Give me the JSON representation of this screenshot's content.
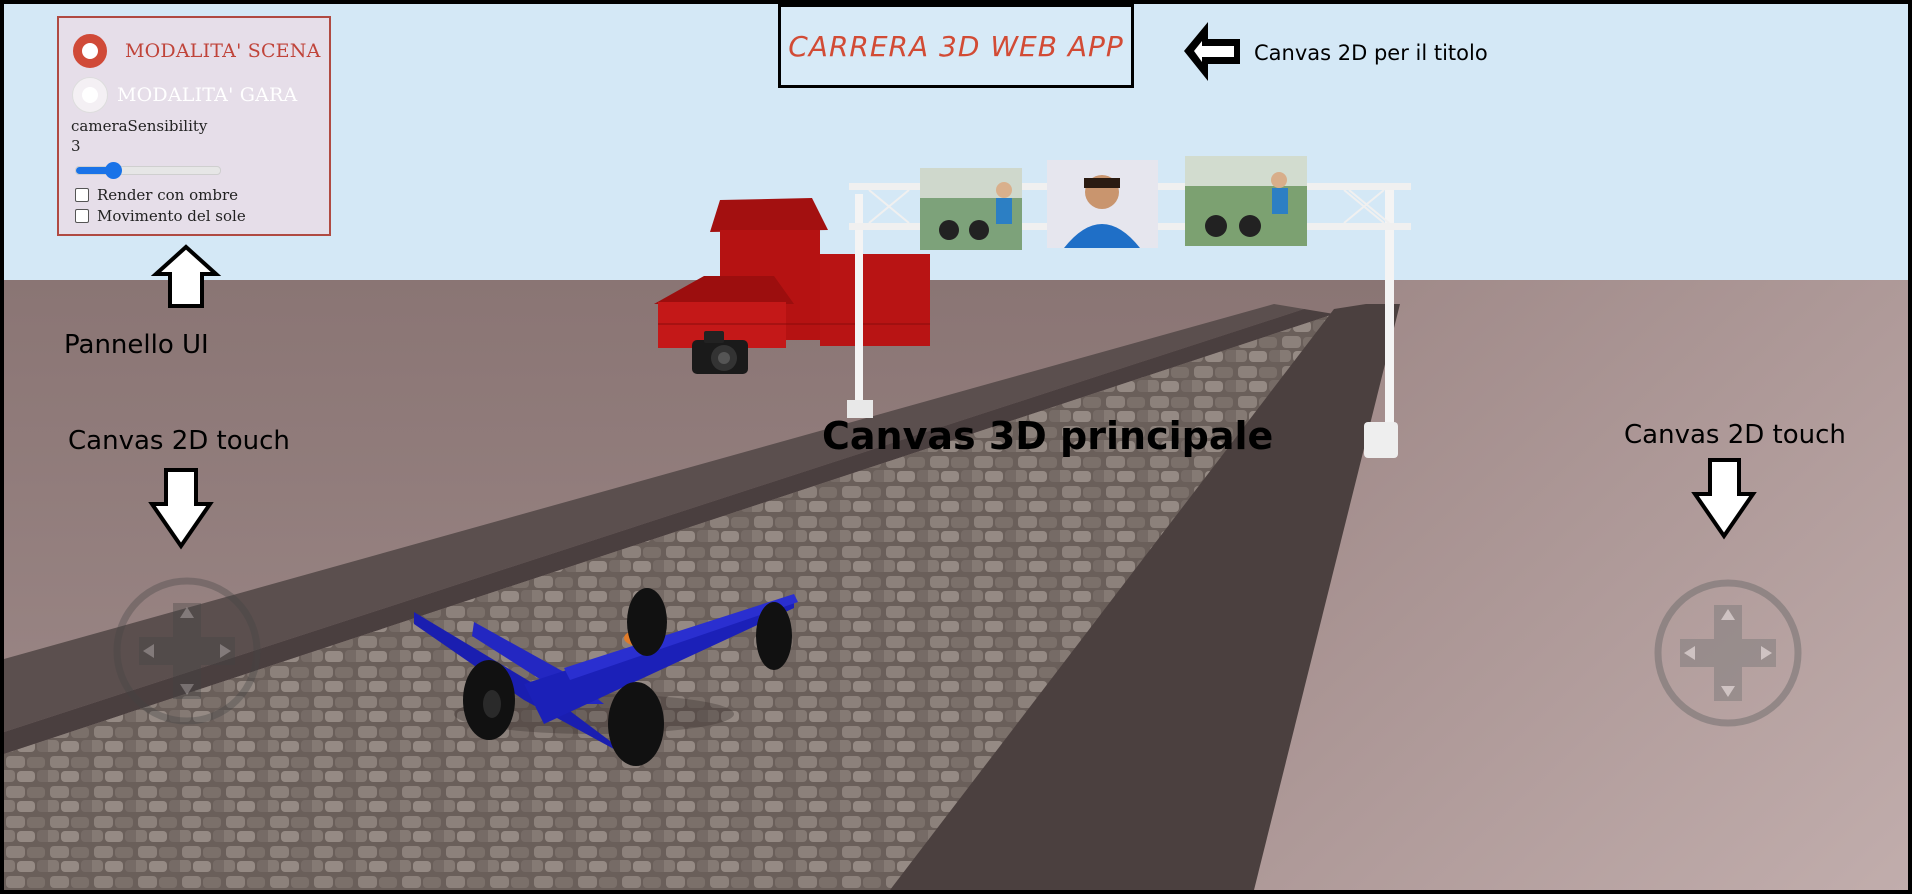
{
  "title": "CARRERA 3D WEB APP",
  "ui_panel": {
    "mode_scene_label": "MODALITA' SCENA",
    "mode_race_label": "MODALITA' GARA",
    "mode_selected": "MODALITA' SCENA",
    "sensitivity_label": "cameraSensibility",
    "sensitivity_value": "3",
    "sensitivity_fraction": 0.26,
    "shadows_label": "Render con ombre",
    "shadows_checked": false,
    "sun_label": "Movimento del sole",
    "sun_checked": false
  },
  "annotations": {
    "title_canvas": "Canvas 2D per il titolo",
    "ui_panel": "Pannello UI",
    "touch_left": "Canvas 2D touch",
    "touch_right": "Canvas 2D touch",
    "main_canvas": "Canvas 3D principale"
  },
  "icons": [
    "radio-selected-icon",
    "radio-unselected-icon",
    "arrow-left-icon",
    "arrow-up-icon",
    "arrow-down-icon",
    "dpad-icon",
    "camera-icon"
  ],
  "colors": {
    "sky": "#d4e8f6",
    "ground": "#a69492",
    "road_curb": "#4a3f3f",
    "car": "#1a1eb0",
    "building": "#b51010",
    "accent": "#d04a38",
    "slider": "#1a73e8"
  }
}
